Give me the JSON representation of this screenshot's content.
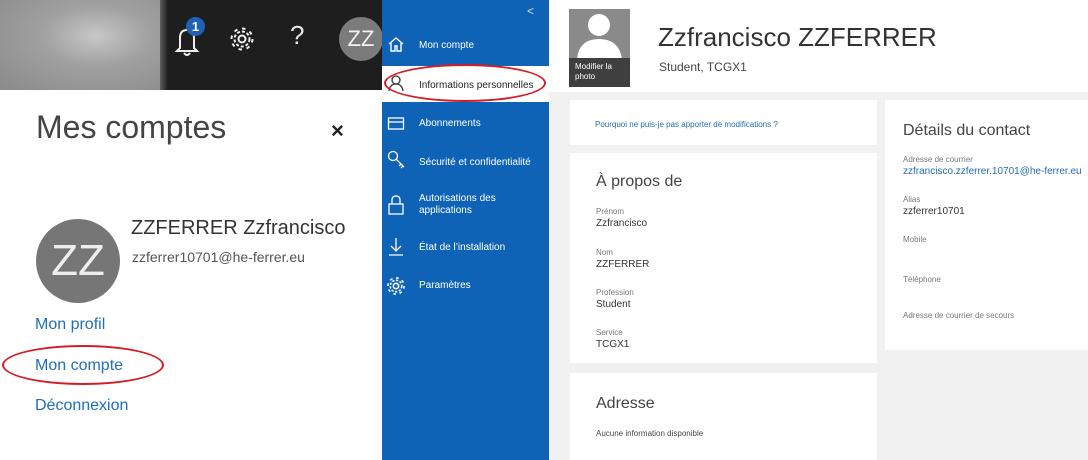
{
  "flyout": {
    "notification_count": "1",
    "avatar_initials": "ZZ",
    "title": "Mes comptes",
    "close_symbol": "×",
    "user_name": "ZZFERRER Zzfrancisco",
    "user_email": "zzferrer10701@he-ferrer.eu",
    "help_symbol": "?",
    "links": [
      "Mon profil",
      "Mon compte",
      "Déconnexion"
    ]
  },
  "nav": {
    "collapse_symbol": "<",
    "items": [
      {
        "label": "Mon compte",
        "icon": "home-icon"
      },
      {
        "label": "Informations personnelles",
        "icon": "person-icon"
      },
      {
        "label": "Abonnements",
        "icon": "card-icon"
      },
      {
        "label": "Sécurité et confidentialité",
        "icon": "key-icon"
      },
      {
        "label_line1": "Autorisations des",
        "label_line2": "applications",
        "icon": "lock-icon"
      },
      {
        "label": "État de l’installation",
        "icon": "download-icon"
      },
      {
        "label": "Paramètres",
        "icon": "gear-icon"
      }
    ]
  },
  "profile": {
    "photo_label_line1": "Modifier la",
    "photo_label_line2": "photo",
    "full_name": "Zzfrancisco ZZFERRER",
    "role": "Student, TCGX1",
    "why_link": "Pourquoi ne puis-je pas apporter de modifications ?",
    "about": {
      "title": "À propos de",
      "fields": [
        {
          "label": "Prénom",
          "value": "Zzfrancisco"
        },
        {
          "label": "Nom",
          "value": "ZZFERRER"
        },
        {
          "label": "Profession",
          "value": "Student"
        },
        {
          "label": "Service",
          "value": "TCGX1"
        }
      ]
    },
    "address": {
      "title": "Adresse",
      "empty": "Aucune information disponible"
    },
    "contact": {
      "title": "Détails du contact",
      "email_label": "Adresse de courrier",
      "email_value": "zzfrancisco.zzferrer.10701@he-ferrer.eu",
      "alias_label": "Alias",
      "alias_value": "zzferrer10701",
      "mobile_label": "Mobile",
      "phone_label": "Téléphone",
      "backup_label": "Adresse de courrier de secours"
    }
  },
  "colors": {
    "nav_blue": "#0f63b6",
    "link_blue": "#1f6fb8",
    "highlight_red": "#d31c24"
  }
}
